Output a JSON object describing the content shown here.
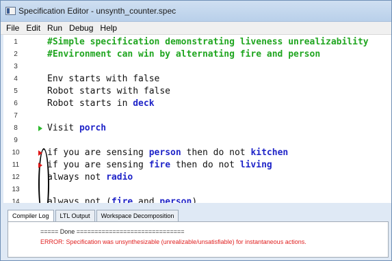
{
  "window": {
    "title": "Specification Editor - unsynth_counter.spec"
  },
  "menu": [
    "File",
    "Edit",
    "Run",
    "Debug",
    "Help"
  ],
  "editor": {
    "lines": [
      {
        "num": "1",
        "segments": [
          {
            "text": "#Simple specification demonstrating liveness unrealizability",
            "style": "comment"
          }
        ]
      },
      {
        "num": "2",
        "segments": [
          {
            "text": "#Environment can win by alternating fire and person",
            "style": "comment"
          }
        ]
      },
      {
        "num": "3",
        "segments": []
      },
      {
        "num": "4",
        "segments": [
          {
            "text": "Env starts with false",
            "style": "plain"
          }
        ]
      },
      {
        "num": "5",
        "segments": [
          {
            "text": "Robot starts with false",
            "style": "plain"
          }
        ]
      },
      {
        "num": "6",
        "segments": [
          {
            "text": "Robot starts in ",
            "style": "plain"
          },
          {
            "text": "deck",
            "style": "kw"
          }
        ]
      },
      {
        "num": "7",
        "segments": []
      },
      {
        "num": "8",
        "marker": "green",
        "segments": [
          {
            "text": "Visit ",
            "style": "plain"
          },
          {
            "text": "porch",
            "style": "kw"
          }
        ]
      },
      {
        "num": "9",
        "segments": []
      },
      {
        "num": "10",
        "marker": "red",
        "segments": [
          {
            "text": "if you are sensing ",
            "style": "plain"
          },
          {
            "text": "person",
            "style": "kw"
          },
          {
            "text": " then do not ",
            "style": "plain"
          },
          {
            "text": "kitchen",
            "style": "kw"
          }
        ]
      },
      {
        "num": "11",
        "marker": "red",
        "segments": [
          {
            "text": "if you are sensing ",
            "style": "plain"
          },
          {
            "text": "fire",
            "style": "kw"
          },
          {
            "text": " then do not ",
            "style": "plain"
          },
          {
            "text": "living",
            "style": "kw"
          }
        ]
      },
      {
        "num": "12",
        "segments": [
          {
            "text": "always not ",
            "style": "plain"
          },
          {
            "text": "radio",
            "style": "kw"
          }
        ]
      },
      {
        "num": "13",
        "segments": []
      },
      {
        "num": "14",
        "segments": [
          {
            "text": "always not (",
            "style": "plain"
          },
          {
            "text": "fire",
            "style": "kw"
          },
          {
            "text": " and ",
            "style": "plain"
          },
          {
            "text": "person",
            "style": "kw"
          },
          {
            "text": ")",
            "style": "plain"
          }
        ]
      }
    ]
  },
  "tabs": [
    "Compiler Log",
    "LTL Output",
    "Workspace Decomposition"
  ],
  "log": {
    "done_line": "===== Done ==============================",
    "error_line": "ERROR: Specification was unsynthesizable (unrealizable/unsatisfiable) for instantaneous actions."
  },
  "colors": {
    "comment": "#1fa51f",
    "keyword": "#1f24c8",
    "error": "#e02020",
    "marker_green": "#2dba2d",
    "marker_red": "#e01616"
  }
}
